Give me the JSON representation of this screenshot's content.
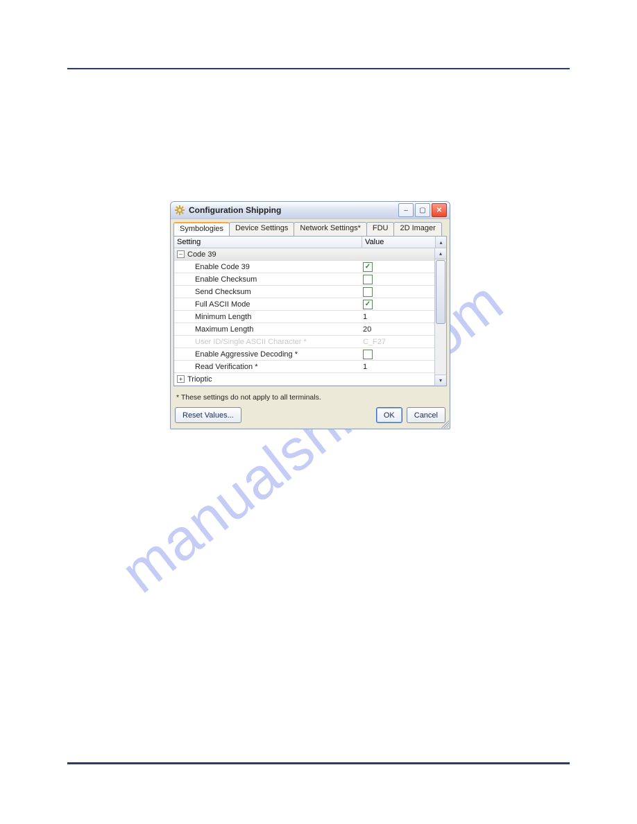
{
  "watermark": "manualshive.com",
  "dialog": {
    "title": "Configuration Shipping",
    "tabs": [
      "Symbologies",
      "Device Settings",
      "Network Settings*",
      "FDU",
      "2D Imager"
    ],
    "active_tab": 0,
    "columns": {
      "setting": "Setting",
      "value": "Value"
    },
    "group_code39": "Code 39",
    "rows": [
      {
        "label": "Enable Code 39",
        "type": "check",
        "checked": true
      },
      {
        "label": "Enable Checksum",
        "type": "check",
        "checked": false
      },
      {
        "label": "Send Checksum",
        "type": "check",
        "checked": false
      },
      {
        "label": "Full ASCII Mode",
        "type": "check",
        "checked": true
      },
      {
        "label": "Minimum Length",
        "type": "text",
        "value": "1"
      },
      {
        "label": "Maximum Length",
        "type": "text",
        "value": "20"
      },
      {
        "label": "User ID/Single ASCII Character *",
        "type": "text",
        "value": "C_F27",
        "disabled": true
      },
      {
        "label": "Enable Aggressive Decoding *",
        "type": "check",
        "checked": false
      },
      {
        "label": "Read Verification *",
        "type": "text",
        "value": "1"
      }
    ],
    "group_trioptic": "Trioptic",
    "footnote": "* These settings do not apply to all terminals.",
    "buttons": {
      "reset": "Reset Values...",
      "ok": "OK",
      "cancel": "Cancel"
    }
  }
}
